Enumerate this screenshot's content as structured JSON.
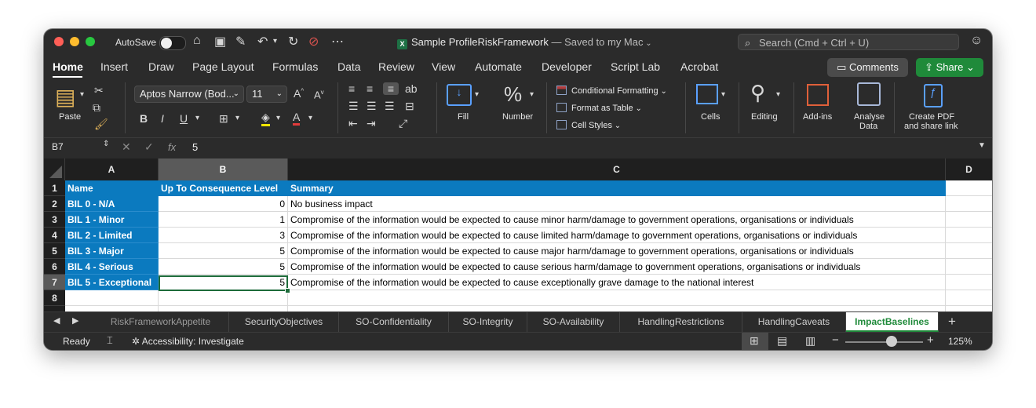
{
  "titlebar": {
    "autosave_label": "AutoSave",
    "document_title": "Sample ProfileRiskFramework",
    "save_status": "— Saved to my Mac",
    "search_placeholder": "Search (Cmd + Ctrl + U)"
  },
  "ribbon_tabs": [
    "Home",
    "Insert",
    "Draw",
    "Page Layout",
    "Formulas",
    "Data",
    "Review",
    "View",
    "Automate",
    "Developer",
    "Script Lab",
    "Acrobat"
  ],
  "ribbon_actions": {
    "comments": "Comments",
    "share": "Share"
  },
  "ribbon": {
    "paste": "Paste",
    "font_name": "Aptos Narrow (Bod...",
    "font_size": "11",
    "fill": "Fill",
    "number": "Number",
    "conditional_formatting": "Conditional Formatting",
    "format_as_table": "Format as Table",
    "cell_styles": "Cell Styles",
    "cells": "Cells",
    "editing": "Editing",
    "addins": "Add-ins",
    "analyse_data_1": "Analyse",
    "analyse_data_2": "Data",
    "create_pdf_1": "Create PDF",
    "create_pdf_2": "and share link"
  },
  "formula_bar": {
    "name_box": "B7",
    "fx": "fx",
    "value": "5"
  },
  "columns": [
    "A",
    "B",
    "C",
    "D"
  ],
  "rows": [
    "1",
    "2",
    "3",
    "4",
    "5",
    "6",
    "7",
    "8"
  ],
  "table": {
    "headers": [
      "Name",
      "Up To Consequence Level",
      "Summary"
    ],
    "rows": [
      {
        "name": "BIL 0 - N/A",
        "level": "0",
        "summary": "No business impact"
      },
      {
        "name": "BIL 1 - Minor",
        "level": "1",
        "summary": "Compromise of the information would be expected to cause minor harm/damage to government operations, organisations or individuals"
      },
      {
        "name": "BIL 2 - Limited",
        "level": "3",
        "summary": "Compromise of the information would be expected to cause limited harm/damage to government operations, organisations or individuals"
      },
      {
        "name": "BIL 3 - Major",
        "level": "5",
        "summary": "Compromise of the information would be expected to cause major harm/damage to government operations, organisations or individuals"
      },
      {
        "name": "BIL 4 - Serious",
        "level": "5",
        "summary": "Compromise of the information would be expected to cause serious harm/damage to government operations, organisations or individuals"
      },
      {
        "name": "BIL 5 - Exceptional",
        "level": "5",
        "summary": "Compromise of the information would be expected to cause exceptionally grave damage to the national interest"
      }
    ]
  },
  "sheet_tabs": [
    "RiskFrameworkAppetite",
    "SecurityObjectives",
    "SO-Confidentiality",
    "SO-Integrity",
    "SO-Availability",
    "HandlingRestrictions",
    "HandlingCaveats",
    "ImpactBaselines"
  ],
  "active_sheet": "ImpactBaselines",
  "status": {
    "ready": "Ready",
    "accessibility": "Accessibility: Investigate",
    "zoom": "125%",
    "zoom_level": 0.6
  },
  "colors": {
    "header_blue": "#0b7abf",
    "excel_green": "#1f8a3a",
    "share_green": "#1f8a3a"
  }
}
